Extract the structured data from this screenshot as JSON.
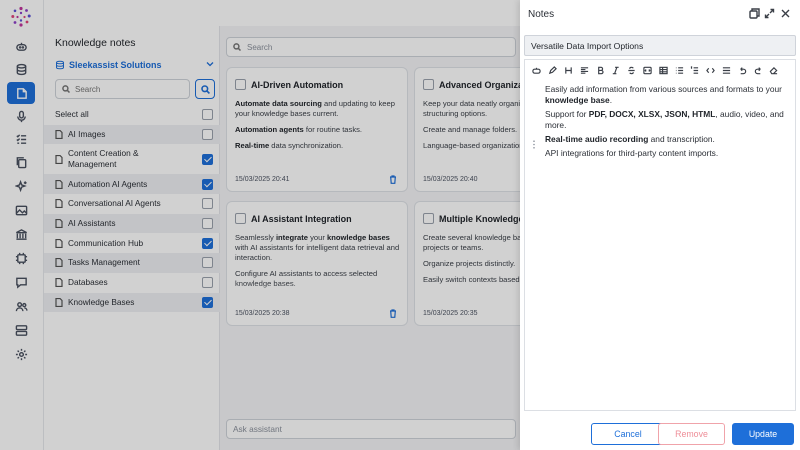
{
  "rail": {
    "icons": [
      "logo-icon",
      "bot-icon",
      "database-icon",
      "notes-icon",
      "microphone-icon",
      "tasks-icon",
      "copy-icon",
      "sparkle-icon",
      "image-icon",
      "bank-icon",
      "chip-icon",
      "chat-icon",
      "users-icon",
      "server-icon",
      "settings-icon"
    ],
    "active": "notes-icon",
    "accent": "#1e6fd9"
  },
  "knowledge": {
    "title": "Knowledge notes",
    "selected_base": "Sleekassist Solutions",
    "search_placeholder": "Search",
    "select_all": "Select all",
    "items": [
      {
        "label": "AI Images",
        "checked": false
      },
      {
        "label": "Content Creation & Management",
        "checked": true
      },
      {
        "label": "Automation AI Agents",
        "checked": true
      },
      {
        "label": "Conversational AI Agents",
        "checked": false
      },
      {
        "label": "AI Assistants",
        "checked": false
      },
      {
        "label": "Communication Hub",
        "checked": true
      },
      {
        "label": "Tasks Management",
        "checked": false
      },
      {
        "label": "Databases",
        "checked": false
      },
      {
        "label": "Knowledge Bases",
        "checked": true
      }
    ]
  },
  "notes_search_placeholder": "Search",
  "cards": [
    {
      "title": "AI-Driven Automation",
      "p1_bold": "Automate data sourcing",
      "p1_rest": " and updating to keep your knowledge bases current.",
      "p2_bold": "Automation agents",
      "p2_rest": " for routine tasks.",
      "p3_bold": "Real-time",
      "p3_rest": " data synchronization.",
      "date": "15/03/2025 20:41"
    },
    {
      "title": "Advanced Organization",
      "p1": "Keep your data neatly organized with flexible structuring options.",
      "p2": "Create and manage folders.",
      "p3": "Language-based organization.",
      "date": "15/03/2025 20:40"
    },
    {
      "title": "AI Assistant Integration",
      "p1_pre": "Seamlessly ",
      "p1_bold": "integrate",
      "p1_mid": " your ",
      "p1_bold2": "knowledge bases",
      "p1_rest": " with AI assistants for intelligent data retrieval and interaction.",
      "p2": "Configure AI assistants to access selected knowledge bases.",
      "date": "15/03/2025 20:38"
    },
    {
      "title": "Multiple Knowledge Bases",
      "p1": "Create several knowledge bases for different projects or teams.",
      "p2": "Organize projects distinctly.",
      "p3": "Easily switch contexts based on project needs.",
      "date": "15/03/2025 20:35"
    }
  ],
  "ask_placeholder": "Ask assistant",
  "drawer": {
    "title": "Notes",
    "note_title": "Versatile Data Import Options",
    "line1": "Easily add information from various sources and formats to your ",
    "line1_bold": "knowledge base",
    "line1_end": ".",
    "line2": "Support for ",
    "line2_bold": "PDF, DOCX, XLSX, JSON, HTML",
    "line2_end": ", audio, video, and more.",
    "line3_bold": "Real-time audio recording",
    "line3_end": " and transcription.",
    "line4": "API integrations for third-party content imports.",
    "cancel": "Cancel",
    "remove": "Remove",
    "update": "Update"
  }
}
